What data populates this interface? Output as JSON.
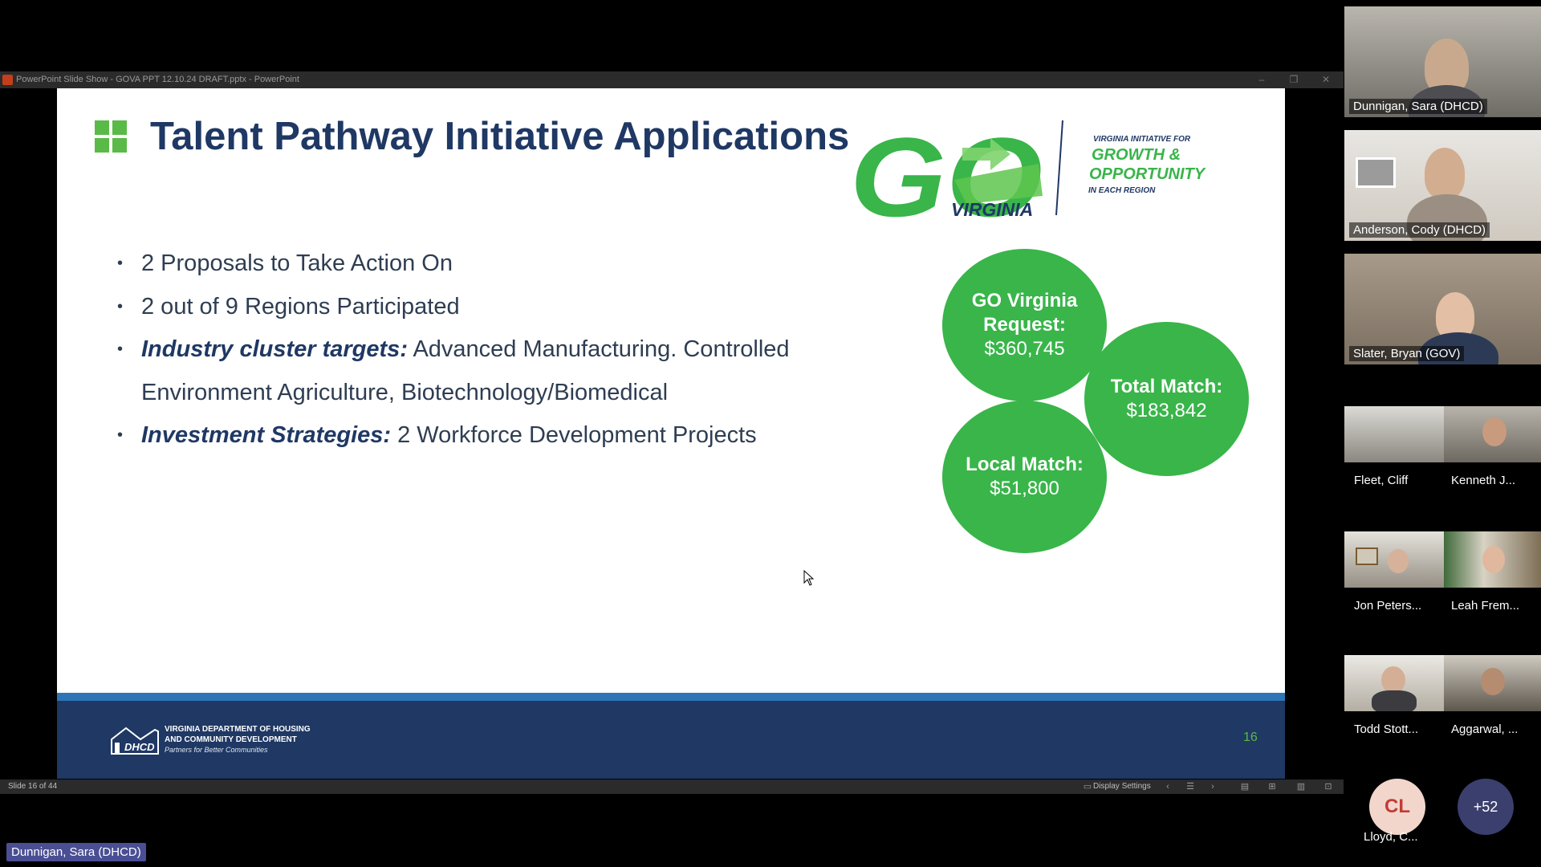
{
  "window": {
    "title": "PowerPoint Slide Show  -  GOVA PPT 12.10.24 DRAFT.pptx - PowerPoint"
  },
  "slide": {
    "title": "Talent Pathway Initiative Applications",
    "logo": {
      "go_text": "GO",
      "virginia_text": "VIRGINIA",
      "line1": "VIRGINIA INITIATIVE FOR",
      "line2": "GROWTH &",
      "line3": "OPPORTUNITY",
      "line4": "IN EACH REGION"
    },
    "bullets": [
      {
        "bold": "",
        "text": "2 Proposals to Take Action On"
      },
      {
        "bold": "",
        "text": "2 out of 9 Regions Participated"
      },
      {
        "bold": "Industry cluster targets:",
        "text": " Advanced Manufacturing. Controlled"
      },
      {
        "bold": "",
        "text": "Environment Agriculture, Biotechnology/Biomedical",
        "continuation": true
      },
      {
        "bold": "Investment Strategies:",
        "text": " 2 Workforce Development Projects"
      }
    ],
    "circles": {
      "request": {
        "label_l1": "GO Virginia",
        "label_l2": "Request:",
        "value": "$360,745"
      },
      "total": {
        "label": "Total Match:",
        "value": "$183,842"
      },
      "local": {
        "label": "Local Match:",
        "value": "$51,800"
      }
    },
    "footer": {
      "org_line1": "VIRGINIA DEPARTMENT OF HOUSING",
      "org_line2": "AND COMMUNITY DEVELOPMENT",
      "tagline": "Partners for Better Communities",
      "logo_text": "DHCD",
      "page_number": "16"
    },
    "colors": {
      "navy": "#1f3864",
      "green": "#39b54a",
      "blue_bar": "#2e75b6"
    }
  },
  "statusbar": {
    "slide_count": "Slide 16 of 44",
    "display_settings": "Display Settings"
  },
  "speaker_tag": "Dunnigan, Sara (DHCD)",
  "participants": {
    "large": [
      {
        "name": "Dunnigan, Sara (DHCD)"
      },
      {
        "name": "Anderson, Cody (DHCD)"
      },
      {
        "name": "Slater, Bryan (GOV)"
      }
    ],
    "small": [
      {
        "name": "Fleet, Cliff"
      },
      {
        "name": "Kenneth J..."
      },
      {
        "name": "Jon Peters..."
      },
      {
        "name": "Leah Frem..."
      },
      {
        "name": "Todd Stott..."
      },
      {
        "name": "Aggarwal, ..."
      }
    ],
    "avatar": {
      "initials": "CL",
      "name": "Lloyd, C..."
    },
    "more": "+52"
  }
}
